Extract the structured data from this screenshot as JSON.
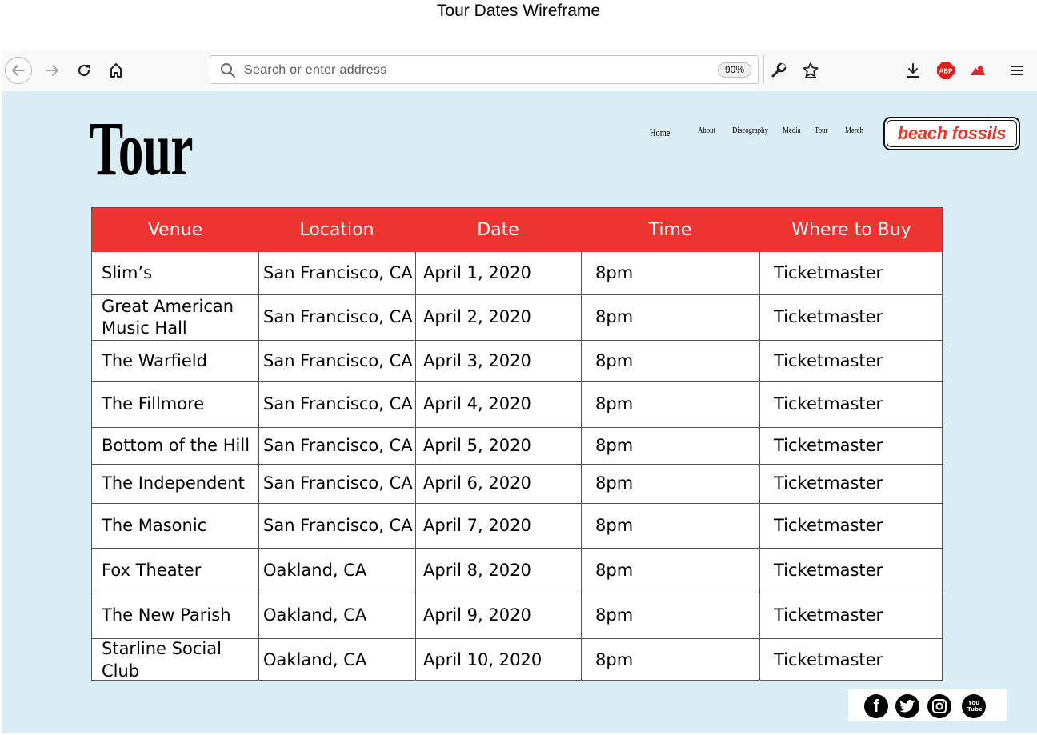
{
  "page_heading": "Tour Dates Wireframe",
  "browser": {
    "url_placeholder": "Search or enter address",
    "zoom": "90%",
    "icons": [
      "back-icon",
      "forward-icon",
      "reload-icon",
      "home-icon",
      "search-icon",
      "wrench-icon",
      "star-icon",
      "download-icon",
      "abp-icon",
      "extension-icon",
      "menu-icon"
    ],
    "abp_label": "ABP"
  },
  "site": {
    "title": "Tour",
    "nav": [
      "Home",
      "About",
      "Discography",
      "Media",
      "Tour",
      "Merch"
    ],
    "logo": "beach fossils",
    "accent_color": "#ee3430",
    "background_color": "#daedf4"
  },
  "table": {
    "headers": [
      "Venue",
      "Location",
      "Date",
      "Time",
      "Where to Buy"
    ],
    "rows": [
      [
        "Slim’s",
        "San Francisco, CA",
        "April 1, 2020",
        "8pm",
        "Ticketmaster"
      ],
      [
        "Great American Music Hall",
        "San Francisco, CA",
        "April 2, 2020",
        "8pm",
        "Ticketmaster"
      ],
      [
        "The Warfield",
        "San Francisco, CA",
        "April 3, 2020",
        "8pm",
        "Ticketmaster"
      ],
      [
        "The Fillmore",
        "San Francisco, CA",
        "April 4, 2020",
        "8pm",
        "Ticketmaster"
      ],
      [
        "Bottom of the Hill",
        "San Francisco, CA",
        "April 5, 2020",
        "8pm",
        "Ticketmaster"
      ],
      [
        "The Independent",
        "San Francisco, CA",
        "April 6, 2020",
        "8pm",
        "Ticketmaster"
      ],
      [
        "The Masonic",
        "San Francisco, CA",
        "April 7, 2020",
        "8pm",
        "Ticketmaster"
      ],
      [
        "Fox Theater",
        "Oakland, CA",
        "April 8, 2020",
        "8pm",
        "Ticketmaster"
      ],
      [
        "The New Parish",
        "Oakland, CA",
        "April 9, 2020",
        "8pm",
        "Ticketmaster"
      ],
      [
        "Starline Social Club",
        "Oakland, CA",
        "April 10, 2020",
        "8pm",
        "Ticketmaster"
      ]
    ]
  },
  "social": {
    "icons": [
      "facebook-icon",
      "twitter-icon",
      "instagram-icon",
      "youtube-icon"
    ],
    "youtube_label": "You Tube"
  }
}
